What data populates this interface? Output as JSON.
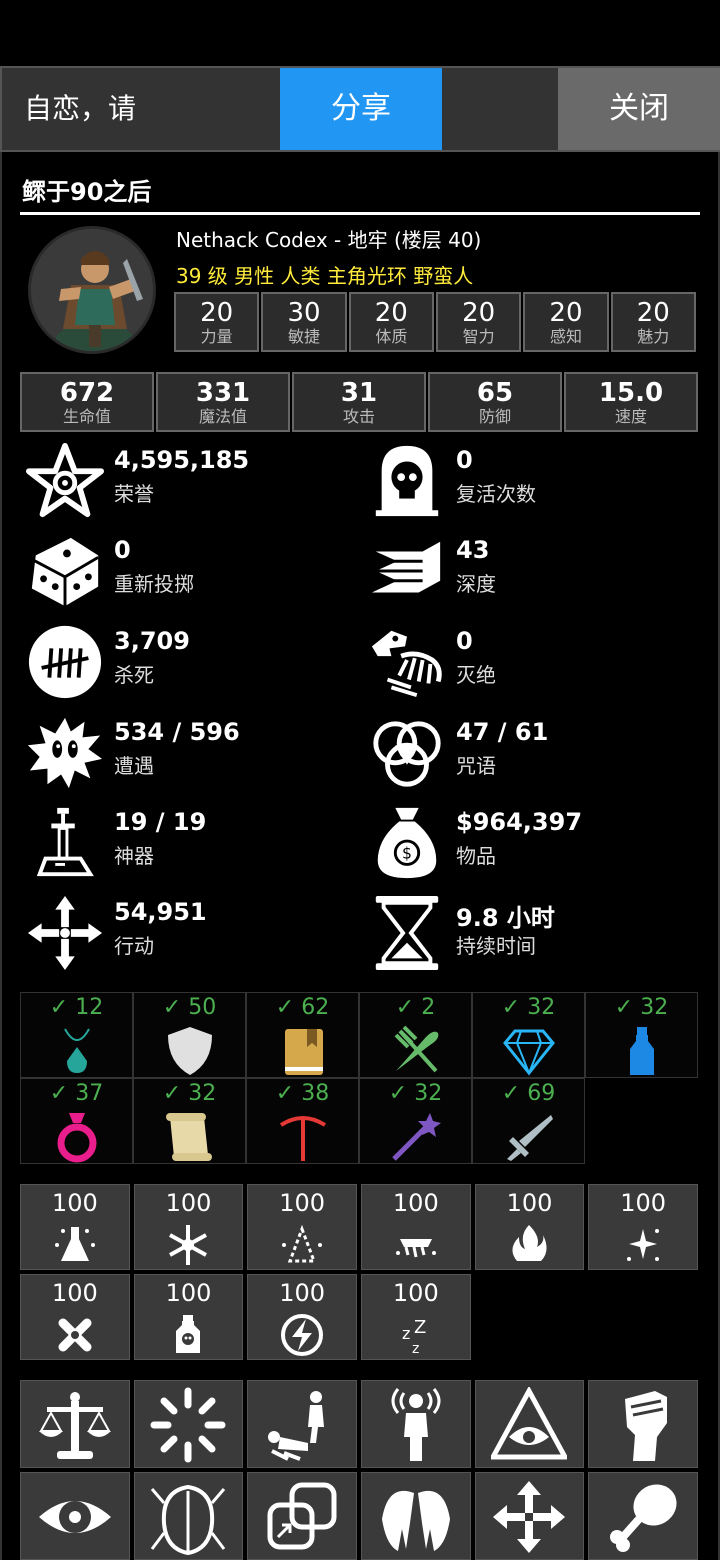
{
  "topbar": {
    "prompt": "自恋，请",
    "share_label": "分享",
    "close_label": "关闭"
  },
  "character": {
    "name": "鳏于90之后",
    "game_line": "Nethack Codex - 地牢 (楼层 40)",
    "class_line": "39 级 男性 人类 主角光环 野蛮人"
  },
  "attributes": [
    {
      "value": "20",
      "label": "力量"
    },
    {
      "value": "30",
      "label": "敏捷"
    },
    {
      "value": "20",
      "label": "体质"
    },
    {
      "value": "20",
      "label": "智力"
    },
    {
      "value": "20",
      "label": "感知"
    },
    {
      "value": "20",
      "label": "魅力"
    }
  ],
  "stats": [
    {
      "value": "672",
      "label": "生命值"
    },
    {
      "value": "331",
      "label": "魔法值"
    },
    {
      "value": "31",
      "label": "攻击"
    },
    {
      "value": "65",
      "label": "防御"
    },
    {
      "value": "15.0",
      "label": "速度"
    }
  ],
  "achievements": [
    {
      "value": "4,595,185",
      "label": "荣誉",
      "icon": "star-badge-icon"
    },
    {
      "value": "0",
      "label": "复活次数",
      "icon": "tombstone-skull-icon"
    },
    {
      "value": "0",
      "label": "重新投掷",
      "icon": "dice-icon"
    },
    {
      "value": "43",
      "label": "深度",
      "icon": "stairs-icon"
    },
    {
      "value": "3,709",
      "label": "杀死",
      "icon": "tally-marks-icon"
    },
    {
      "value": "0",
      "label": "灭绝",
      "icon": "dino-skeleton-icon"
    },
    {
      "value": "534 / 596",
      "label": "遭遇",
      "icon": "monster-icon"
    },
    {
      "value": "47 / 61",
      "label": "咒语",
      "icon": "triquetra-icon"
    },
    {
      "value": "19 / 19",
      "label": "神器",
      "icon": "sword-in-stone-icon"
    },
    {
      "value": "$964,397",
      "label": "物品",
      "icon": "money-bag-icon"
    },
    {
      "value": "54,951",
      "label": "行动",
      "icon": "move-arrows-icon"
    },
    {
      "value": "9.8 小时",
      "label": "持续时间",
      "icon": "hourglass-icon"
    }
  ],
  "item_checks": [
    {
      "count": "✓ 12",
      "icon": "amulet-icon",
      "color": "#26a69a"
    },
    {
      "count": "✓ 50",
      "icon": "shield-icon",
      "color": "#e0e0e0"
    },
    {
      "count": "✓ 62",
      "icon": "book-icon",
      "color": "#d4a84b"
    },
    {
      "count": "✓ 2",
      "icon": "fork-knife-icon",
      "color": "#66bb6a"
    },
    {
      "count": "✓ 32",
      "icon": "gem-icon",
      "color": "#29b6f6"
    },
    {
      "count": "✓ 32",
      "icon": "potion-bottle-icon",
      "color": "#1e88e5"
    },
    {
      "count": "✓ 37",
      "icon": "ring-icon",
      "color": "#e91e8c"
    },
    {
      "count": "✓ 32",
      "icon": "scroll-icon",
      "color": "#e8d9a8"
    },
    {
      "count": "✓ 38",
      "icon": "pickaxe-icon",
      "color": "#e53935"
    },
    {
      "count": "✓ 32",
      "icon": "wand-icon",
      "color": "#7e57c2"
    },
    {
      "count": "✓ 69",
      "icon": "sword-icon",
      "color": "#b0bec5"
    }
  ],
  "resistances": [
    {
      "value": "100",
      "icon": "acid-flask-icon"
    },
    {
      "value": "100",
      "icon": "cold-snowflake-icon"
    },
    {
      "value": "100",
      "icon": "disintegration-icon"
    },
    {
      "value": "100",
      "icon": "shock-icon"
    },
    {
      "value": "100",
      "icon": "fire-icon"
    },
    {
      "value": "100",
      "icon": "magic-sparkles-icon"
    },
    {
      "value": "100",
      "icon": "poison-cross-icon"
    },
    {
      "value": "100",
      "icon": "poison-bottle-icon"
    },
    {
      "value": "100",
      "icon": "lightning-icon"
    },
    {
      "value": "100",
      "icon": "sleep-icon"
    }
  ],
  "intrinsics": [
    {
      "icon": "balance-scale-icon"
    },
    {
      "icon": "radiance-icon"
    },
    {
      "icon": "knockdown-icon"
    },
    {
      "icon": "telepathy-icon"
    },
    {
      "icon": "all-seeing-eye-icon"
    },
    {
      "icon": "fist-icon"
    },
    {
      "icon": "eye-icon"
    },
    {
      "icon": "beetle-icon"
    },
    {
      "icon": "teleport-squares-icon"
    },
    {
      "icon": "wings-icon"
    },
    {
      "icon": "four-arrows-icon"
    },
    {
      "icon": "drumstick-icon"
    }
  ]
}
